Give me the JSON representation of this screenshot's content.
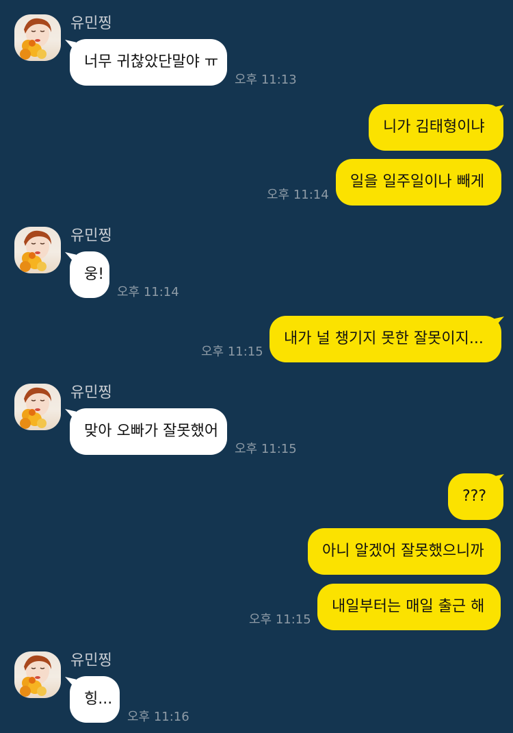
{
  "sender": {
    "name": "유민찡"
  },
  "messages": [
    {
      "side": "in",
      "text": "너무 귀찮았단말야 ㅠ",
      "time": "오후 11:13"
    },
    {
      "side": "out",
      "text": "니가 김태형이냐"
    },
    {
      "side": "out",
      "text": "일을 일주일이나 빼게",
      "time": "오후 11:14"
    },
    {
      "side": "in",
      "text": "웅!",
      "time": "오후 11:14"
    },
    {
      "side": "out",
      "text": "내가 널 챙기지 못한 잘못이지...",
      "time": "오후 11:15"
    },
    {
      "side": "in",
      "text": "맞아 오빠가 잘못했어",
      "time": "오후 11:15"
    },
    {
      "side": "out",
      "text": "???"
    },
    {
      "side": "out",
      "text": "아니 알겠어 잘못했으니까"
    },
    {
      "side": "out",
      "text": "내일부터는 매일 출근 해",
      "time": "오후 11:15"
    },
    {
      "side": "in",
      "text": "힝...",
      "time": "오후 11:16"
    }
  ],
  "colors": {
    "background": "#143550",
    "incoming_bubble": "#ffffff",
    "outgoing_bubble": "#fbe200",
    "timestamp": "#8e9ba6",
    "sender_name": "#c7ccd2"
  }
}
